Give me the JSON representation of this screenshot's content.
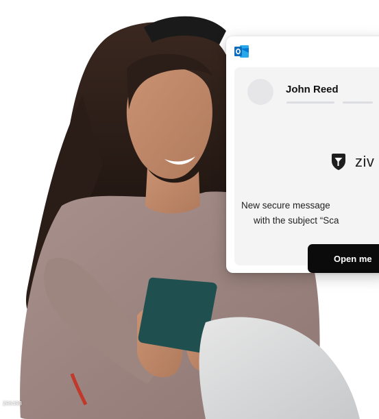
{
  "photo": {
    "stock_id": "296498",
    "subject": "woman-smiling-at-phone"
  },
  "email_card": {
    "app_icon": "outlook-icon",
    "sender_name": "John Reed",
    "brand_logo_icon": "shield-logo-icon",
    "brand_name": "ziv",
    "message_line_1": "New secure message",
    "message_line_2": "with the subject “Sca",
    "open_button_label": "Open me",
    "colors": {
      "button_bg": "#0b0b0b",
      "button_text": "#ffffff",
      "panel_bg": "#f4f4f5",
      "outlook_blue": "#0f6cbd"
    }
  }
}
